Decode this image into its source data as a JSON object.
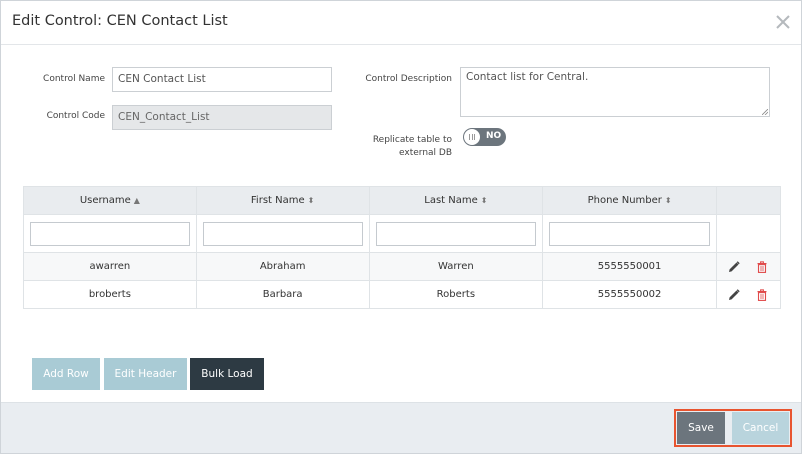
{
  "dialog": {
    "title": "Edit Control: CEN Contact List",
    "close_label": "X"
  },
  "form": {
    "control_name_label": "Control Name",
    "control_name_value": "CEN Contact List",
    "control_code_label": "Control Code",
    "control_code_value": "CEN_Contact_List",
    "control_description_label": "Control Description",
    "control_description_value": "Contact list for Central.",
    "replicate_label_line1": "Replicate table to",
    "replicate_label_line2": "external DB",
    "replicate_toggle_text": "NO"
  },
  "table": {
    "columns": [
      {
        "label": "Username",
        "sort": "▲"
      },
      {
        "label": "First Name",
        "sort": "⬍"
      },
      {
        "label": "Last Name",
        "sort": "⬍"
      },
      {
        "label": "Phone Number",
        "sort": "⬍"
      }
    ],
    "rows": [
      {
        "username": "awarren",
        "first_name": "Abraham",
        "last_name": "Warren",
        "phone": "5555550001"
      },
      {
        "username": "broberts",
        "first_name": "Barbara",
        "last_name": "Roberts",
        "phone": "5555550002"
      }
    ],
    "row_icons": {
      "edit": "pencil-icon",
      "delete": "trash-icon"
    }
  },
  "buttons": {
    "add_row": "Add Row",
    "edit_header": "Edit Header",
    "bulk_load": "Bulk Load",
    "save": "Save",
    "cancel": "Cancel"
  },
  "colors": {
    "highlight": "#e8542f",
    "dark_button": "#2d3a43",
    "disabled_button": "#a9cbd5",
    "delete_icon": "#e04a4a"
  }
}
